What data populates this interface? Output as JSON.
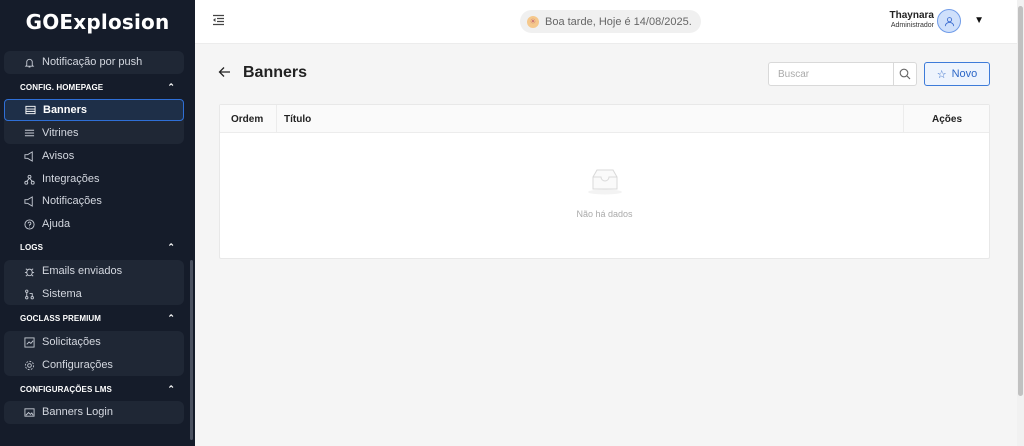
{
  "app": {
    "logo_go": "GO",
    "logo_rest": "Explosion"
  },
  "sidebar": {
    "push_item": "Notificação por push",
    "sections": {
      "homepage": "CONFIG. HOMEPAGE",
      "logs": "LOGS",
      "goclass": "GOCLASS PREMIUM",
      "lms": "CONFIGURAÇÕES LMS"
    },
    "items": {
      "banners": "Banners",
      "vitrines": "Vitrines",
      "avisos": "Avisos",
      "integracoes": "Integrações",
      "notificacoes": "Notificações",
      "ajuda": "Ajuda",
      "emails": "Emails enviados",
      "sistema": "Sistema",
      "solicitacoes": "Solicitações",
      "configuracoes": "Configurações",
      "banners_login": "Banners Login"
    }
  },
  "header": {
    "greeting": "Boa tarde, Hoje é 14/08/2025.",
    "user_name": "Thaynara",
    "user_role": "Administrador"
  },
  "page": {
    "title": "Banners",
    "search_placeholder": "Buscar",
    "new_button": "Novo",
    "columns": {
      "ordem": "Ordem",
      "titulo": "Título",
      "acoes": "Ações"
    },
    "empty_text": "Não há dados"
  },
  "colors": {
    "sidebar_bg": "#151c2a",
    "accent": "#2f6fd6"
  },
  "icons": [
    "bell-icon",
    "banner-list-icon",
    "showcase-icon",
    "megaphone-icon",
    "integration-icon",
    "notification-icon",
    "help-icon",
    "bug-icon",
    "git-branch-icon",
    "chart-icon",
    "gear-icon",
    "image-icon",
    "menu-fold-icon",
    "sun-icon",
    "user-icon",
    "caret-down-icon",
    "arrow-left-icon",
    "search-icon",
    "star-icon",
    "empty-inbox-icon"
  ]
}
